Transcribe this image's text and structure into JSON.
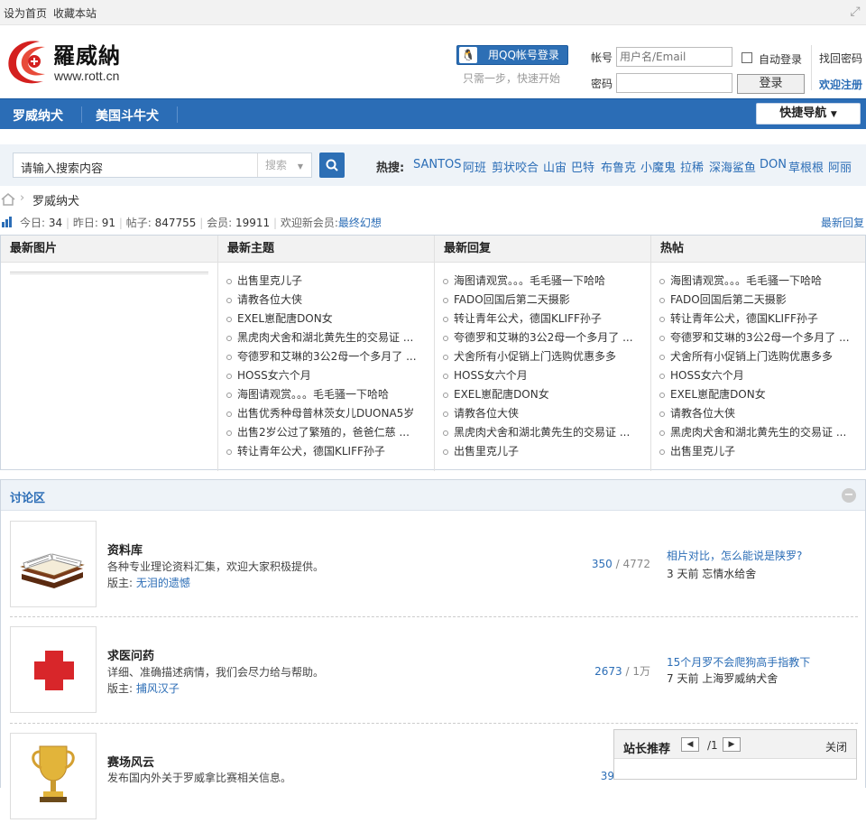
{
  "topbar": {
    "set_home": "设为首页",
    "bookmark": "收藏本站"
  },
  "logo": {
    "name": "羅威納",
    "url": "www.rott.cn"
  },
  "qq_login": {
    "label": "用QQ帐号登录",
    "tip": "只需一步，快速开始"
  },
  "login": {
    "account_label": "帐号",
    "account_placeholder": "用户名/Email",
    "password_label": "密码",
    "auto_login": "自动登录",
    "find_password": "找回密码",
    "register": "欢迎注册",
    "submit": "登录"
  },
  "nav": {
    "items": [
      "罗威纳犬",
      "美国斗牛犬"
    ],
    "quick": "快捷导航"
  },
  "search": {
    "placeholder": "请输入搜索内容",
    "scope": "搜索",
    "hot_label": "热搜:",
    "hot": [
      "SANTOS",
      "阿班",
      "剪状咬合",
      "山宙",
      "巴特",
      "布鲁克",
      "小魔鬼",
      "拉稀",
      "深海鲨鱼",
      "DON",
      "草根根",
      "阿丽"
    ]
  },
  "breadcrumb": {
    "current": "罗威纳犬"
  },
  "stats": {
    "today_label": "今日:",
    "today": "34",
    "yesterday_label": "昨日:",
    "yesterday": "91",
    "posts_label": "帖子:",
    "posts": "847755",
    "members_label": "会员:",
    "members": "19911",
    "welcome_label": "欢迎新会员:",
    "newest_member": "最终幻想",
    "latest_reply_link": "最新回复"
  },
  "panels": {
    "headers": [
      "最新图片",
      "最新主题",
      "最新回复",
      "热帖"
    ],
    "latest_topics": [
      "出售里克儿子",
      "请教各位大侠",
      "EXEL崽配唐DON女",
      "黑虎肉犬舍和湖北黄先生的交易证 ...",
      "夸德罗和艾琳的3公2母一个多月了 ...",
      "HOSS女六个月",
      "海图请观赏。。。毛毛骚一下哈哈",
      "出售优秀种母普林茨女儿DUONA5岁",
      "出售2岁公过了繁殖的，爸爸仁慈 ...",
      "转让青年公犬，德国KLIFF孙子"
    ],
    "latest_replies": [
      "海图请观赏。。。毛毛骚一下哈哈",
      "FADO回国后第二天摄影",
      "转让青年公犬，德国KLIFF孙子",
      "夸德罗和艾琳的3公2母一个多月了 ...",
      "犬舍所有小促销上门选购优惠多多",
      "HOSS女六个月",
      "EXEL崽配唐DON女",
      "请教各位大侠",
      "黑虎肉犬舍和湖北黄先生的交易证 ...",
      "出售里克儿子"
    ],
    "hot_posts": [
      "海图请观赏。。。毛毛骚一下哈哈",
      "FADO回国后第二天摄影",
      "转让青年公犬，德国KLIFF孙子",
      "夸德罗和艾琳的3公2母一个多月了 ...",
      "犬舍所有小促销上门选购优惠多多",
      "HOSS女六个月",
      "EXEL崽配唐DON女",
      "请教各位大侠",
      "黑虎肉犬舍和湖北黄先生的交易证 ...",
      "出售里克儿子"
    ]
  },
  "forum": {
    "title": "讨论区",
    "boards": [
      {
        "icon": "book-icon",
        "name": "资料库",
        "desc": "各种专业理论资料汇集，欢迎大家积极提供。",
        "mod_label": "版主:",
        "mod": "无泪的遗憾",
        "threads": "350",
        "posts": "4772",
        "last_title": "相片对比，怎么能说是陕罗?",
        "last_time": "3 天前",
        "last_user": "忘情水给舍"
      },
      {
        "icon": "red-cross-icon",
        "name": "求医问药",
        "desc": "详细、准确描述病情，我们会尽力给与帮助。",
        "mod_label": "版主:",
        "mod": "捕风汉子",
        "threads": "2673",
        "posts": "1万",
        "last_title": "15个月罗不会爬狗高手指教下",
        "last_time": "7 天前",
        "last_user": "上海罗威纳犬舍"
      },
      {
        "icon": "trophy-icon",
        "name": "赛场风云",
        "desc": "发布国内外关于罗威拿比赛相关信息。",
        "mod_label": "",
        "mod": "",
        "threads": "39",
        "posts": "",
        "last_title": "",
        "last_time": "",
        "last_user": ""
      }
    ]
  },
  "popup": {
    "title": "站长推荐",
    "page": "/1",
    "close": "关闭"
  },
  "colors": {
    "brand_blue": "#2b6db6",
    "link_blue": "#2b6db6",
    "logo_red": "#d4201f"
  }
}
